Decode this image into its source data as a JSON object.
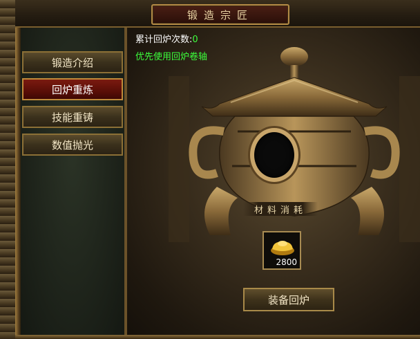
{
  "window": {
    "title": "锻造宗匠"
  },
  "sidebar": {
    "items": [
      {
        "label": "锻造介绍",
        "active": false
      },
      {
        "label": "回炉重炼",
        "active": true
      },
      {
        "label": "技能重铸",
        "active": false
      },
      {
        "label": "数值抛光",
        "active": false
      }
    ]
  },
  "main": {
    "count_label": "累计回炉次数:",
    "count_value": "0",
    "hint": "优先使用回炉卷轴",
    "material_label": "材料消耗",
    "material": {
      "icon": "gold-ingot-icon",
      "count": "2800"
    },
    "action_button": "装备回炉"
  },
  "colors": {
    "accent_green": "#3cff3c",
    "active_tab": "#7a1a10",
    "frame_gold": "#b48a45"
  }
}
